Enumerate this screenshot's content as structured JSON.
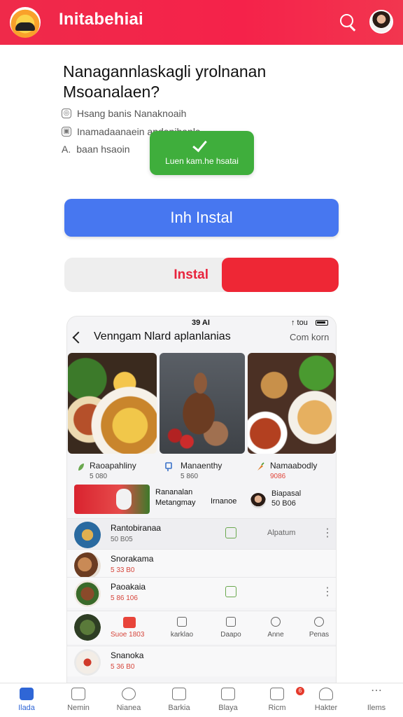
{
  "header": {
    "app_title": "Initabehiai",
    "search_icon": "search-icon",
    "avatar_icon": "avatar"
  },
  "intro": {
    "headline_line1": "Nanagannlaskagli yrolnanan",
    "headline_line2": "Msoanalaen?",
    "info": [
      {
        "icon": "location-icon",
        "text": "Hsang banis Nanaknoaih"
      },
      {
        "icon": "lock-icon",
        "text": "Inamadaanaein andanihanla"
      },
      {
        "icon": "font-icon",
        "text": "baan hsaoin"
      }
    ],
    "toast_text": "Luen kam.he hsatai"
  },
  "buttons": {
    "primary_label": "Inh Instal",
    "split_label": "Instal"
  },
  "phone": {
    "status_time": "39 AI",
    "status_signal": "↑ tou",
    "nav_title": "Venngam Nlard aplanlanias",
    "nav_action": "Com korn",
    "photos": [
      "food-platter-photo",
      "person-photo",
      "meal-photo"
    ],
    "captions": [
      {
        "title": "Raoapahliny",
        "sub": "5 080"
      },
      {
        "title": "Manaenthy",
        "sub": "5 860"
      },
      {
        "title": "Namaabodly",
        "sub": "9086"
      }
    ],
    "promo": {
      "text_line1": "Rananalan",
      "text_line2": "Metangmay",
      "tag": "Irnanoe",
      "right_line1": "Biapasal",
      "right_line2": "50 B06"
    },
    "list": [
      {
        "title": "Rantobiranaa",
        "sub": "50 B05",
        "side": "Alpatum"
      },
      {
        "title": "Snorakama",
        "sub": "5 33 B0"
      },
      {
        "title": "Paoakaia",
        "sub": "5 86 106"
      },
      {
        "title": "",
        "sub": "Suoe 1803",
        "badge": "8"
      },
      {
        "title": "Snanoka",
        "sub": "5 36 B0"
      }
    ],
    "mini_tabs": [
      "karklao",
      "Daapo",
      "Anne",
      "Penas"
    ]
  },
  "bottom_nav": [
    {
      "label": "Ilada",
      "icon": "home-icon",
      "active": true
    },
    {
      "label": "Nemin",
      "icon": "store-icon"
    },
    {
      "label": "Nianea",
      "icon": "search-icon"
    },
    {
      "label": "Barkia",
      "icon": "box-icon"
    },
    {
      "label": "Blaya",
      "icon": "image-icon"
    },
    {
      "label": "Ricm",
      "icon": "cart-icon",
      "badge": "6"
    },
    {
      "label": "Hakter",
      "icon": "user-icon"
    },
    {
      "label": "Ilems",
      "icon": "more-icon"
    }
  ]
}
